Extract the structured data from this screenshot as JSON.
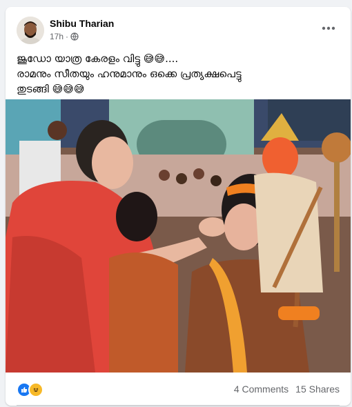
{
  "post": {
    "author": "Shibu Tharian",
    "time": "17h",
    "privacy_icon": "globe-icon",
    "text_lines": [
      "ജൂഡോ യാത്ര കേരളം വിട്ടു 😅😅....",
      "രാമനും സീതയും ഹനുമാനും ഒക്കെ പ്രത്യക്ഷപെട്ടു",
      "തുടങ്ങി 😅😅😅"
    ]
  },
  "footer": {
    "reactions": [
      "like-icon",
      "haha-icon"
    ],
    "comments": "4 Comments",
    "shares": "15 Shares"
  },
  "colors": {
    "like_blue": "#1877f2",
    "haha_yellow": "#f7b928",
    "muted_text": "#65676b"
  }
}
